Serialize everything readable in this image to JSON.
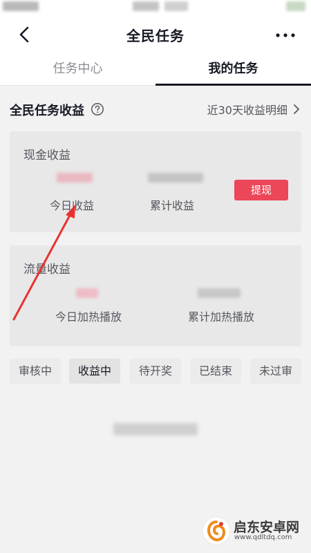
{
  "header": {
    "title": "全民任务",
    "back_icon": "chevron-left-icon",
    "more_icon": "more-dots-icon"
  },
  "tabs": [
    {
      "label": "任务中心",
      "active": false
    },
    {
      "label": "我的任务",
      "active": true
    }
  ],
  "earnings_section": {
    "title": "全民任务收益",
    "help_icon": "question-circle-icon",
    "detail_link": "近30天收益明细"
  },
  "cash_card": {
    "title": "现金收益",
    "today_label": "今日收益",
    "total_label": "累计收益",
    "withdraw_label": "提现"
  },
  "flow_card": {
    "title": "流量收益",
    "today_label": "今日加热播放",
    "total_label": "累计加热播放"
  },
  "filters": [
    {
      "label": "审核中",
      "active": false
    },
    {
      "label": "收益中",
      "active": true
    },
    {
      "label": "待开奖",
      "active": false
    },
    {
      "label": "已结束",
      "active": false
    },
    {
      "label": "未过审",
      "active": false
    }
  ],
  "watermark": {
    "title": "启东安卓网",
    "url": "www.qdltdq.com"
  },
  "colors": {
    "accent": "#ec4659",
    "annotation_arrow": "#e8322f",
    "text_primary": "#161823",
    "text_secondary": "#55575e"
  }
}
